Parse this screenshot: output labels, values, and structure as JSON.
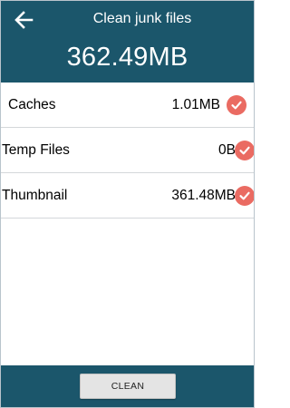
{
  "header": {
    "title": "Clean junk files",
    "total_size": "362.49MB",
    "back_icon": "arrow-left-icon"
  },
  "items": [
    {
      "label": "Caches",
      "size": "1.01MB",
      "checked": true
    },
    {
      "label": "Temp Files",
      "size": "0B",
      "checked": true
    },
    {
      "label": "Thumbnail",
      "size": "361.48MB",
      "checked": true
    }
  ],
  "footer": {
    "clean_label": "CLEAN"
  },
  "colors": {
    "primary": "#1b566b",
    "check": "#ea6b62",
    "button_bg": "#e4e4e4"
  }
}
